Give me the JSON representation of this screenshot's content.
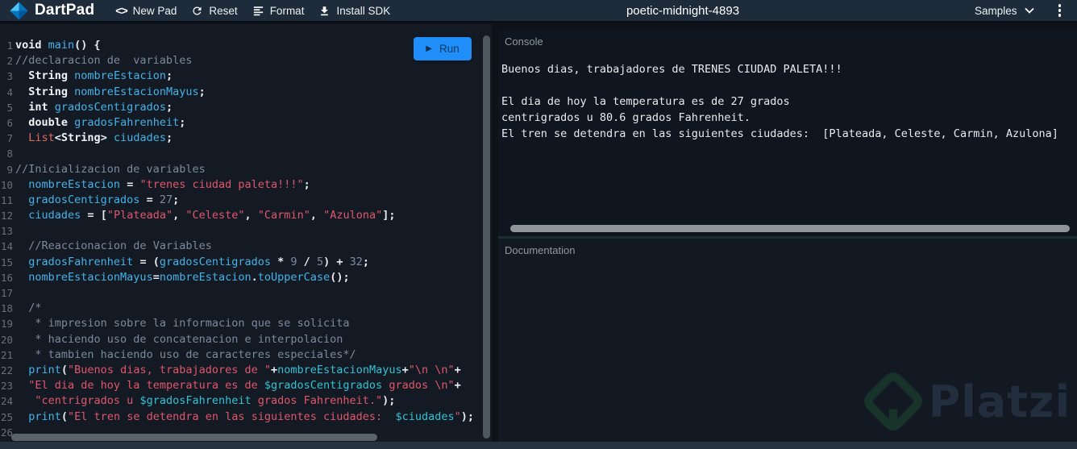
{
  "topbar": {
    "brand": "DartPad",
    "nav": [
      {
        "label": "New Pad",
        "icon": "code-icon"
      },
      {
        "label": "Reset",
        "icon": "refresh-icon"
      },
      {
        "label": "Format",
        "icon": "format-align-icon"
      },
      {
        "label": "Install SDK",
        "icon": "download-icon"
      }
    ],
    "title": "poetic-midnight-4893",
    "samples_label": "Samples"
  },
  "editor": {
    "run_label": "Run",
    "lines": [
      {
        "n": 1,
        "seg": [
          [
            "kw",
            "void "
          ],
          [
            "id",
            "main"
          ],
          [
            "pn",
            "() {"
          ]
        ]
      },
      {
        "n": 2,
        "seg": [
          [
            "cm",
            "//declaracion de  variables"
          ]
        ]
      },
      {
        "n": 3,
        "seg": [
          [
            "pl",
            "  "
          ],
          [
            "kw",
            "String "
          ],
          [
            "id",
            "nombreEstacion"
          ],
          [
            "pn",
            ";"
          ]
        ]
      },
      {
        "n": 4,
        "seg": [
          [
            "pl",
            "  "
          ],
          [
            "kw",
            "String "
          ],
          [
            "id",
            "nombreEstacionMayus"
          ],
          [
            "pn",
            ";"
          ]
        ]
      },
      {
        "n": 5,
        "seg": [
          [
            "pl",
            "  "
          ],
          [
            "kw",
            "int "
          ],
          [
            "id",
            "gradosCentigrados"
          ],
          [
            "pn",
            ";"
          ]
        ]
      },
      {
        "n": 6,
        "seg": [
          [
            "pl",
            "  "
          ],
          [
            "kw",
            "double "
          ],
          [
            "id",
            "gradosFahrenheit"
          ],
          [
            "pn",
            ";"
          ]
        ]
      },
      {
        "n": 7,
        "seg": [
          [
            "pl",
            "  "
          ],
          [
            "ty",
            "List"
          ],
          [
            "pn",
            "<"
          ],
          [
            "kw",
            "String"
          ],
          [
            "pn",
            "> "
          ],
          [
            "id",
            "ciudades"
          ],
          [
            "pn",
            ";"
          ]
        ]
      },
      {
        "n": 8,
        "seg": []
      },
      {
        "n": 9,
        "seg": [
          [
            "cm",
            "//Inicializacion de variables"
          ]
        ]
      },
      {
        "n": 10,
        "seg": [
          [
            "pl",
            "  "
          ],
          [
            "id",
            "nombreEstacion"
          ],
          [
            "op",
            " = "
          ],
          [
            "st",
            "\"trenes ciudad paleta!!!\""
          ],
          [
            "pn",
            ";"
          ]
        ]
      },
      {
        "n": 11,
        "seg": [
          [
            "pl",
            "  "
          ],
          [
            "id",
            "gradosCentigrados"
          ],
          [
            "op",
            " = "
          ],
          [
            "nu",
            "27"
          ],
          [
            "pn",
            ";"
          ]
        ]
      },
      {
        "n": 12,
        "seg": [
          [
            "pl",
            "  "
          ],
          [
            "id",
            "ciudades"
          ],
          [
            "op",
            " = "
          ],
          [
            "pn",
            "["
          ],
          [
            "st",
            "\"Plateada\""
          ],
          [
            "pn",
            ", "
          ],
          [
            "st",
            "\"Celeste\""
          ],
          [
            "pn",
            ", "
          ],
          [
            "st",
            "\"Carmin\""
          ],
          [
            "pn",
            ", "
          ],
          [
            "st",
            "\"Azulona\""
          ],
          [
            "pn",
            "];"
          ]
        ]
      },
      {
        "n": 13,
        "seg": []
      },
      {
        "n": 14,
        "seg": [
          [
            "pl",
            "  "
          ],
          [
            "cm",
            "//Reaccionacion de Variables"
          ]
        ]
      },
      {
        "n": 15,
        "seg": [
          [
            "pl",
            "  "
          ],
          [
            "id",
            "gradosFahrenheit"
          ],
          [
            "op",
            " = "
          ],
          [
            "pn",
            "("
          ],
          [
            "id",
            "gradosCentigrados"
          ],
          [
            "op",
            " * "
          ],
          [
            "nu",
            "9"
          ],
          [
            "op",
            " / "
          ],
          [
            "nu",
            "5"
          ],
          [
            "pn",
            ")"
          ],
          [
            "op",
            " + "
          ],
          [
            "nu",
            "32"
          ],
          [
            "pn",
            ";"
          ]
        ]
      },
      {
        "n": 16,
        "seg": [
          [
            "pl",
            "  "
          ],
          [
            "id",
            "nombreEstacionMayus"
          ],
          [
            "op",
            "="
          ],
          [
            "id",
            "nombreEstacion"
          ],
          [
            "pn",
            "."
          ],
          [
            "id",
            "toUpperCase"
          ],
          [
            "pn",
            "();"
          ]
        ]
      },
      {
        "n": 17,
        "seg": []
      },
      {
        "n": 18,
        "seg": [
          [
            "pl",
            "  "
          ],
          [
            "cm",
            "/*"
          ]
        ]
      },
      {
        "n": 19,
        "seg": [
          [
            "pl",
            "  "
          ],
          [
            "cm",
            " * impresion sobre la informacion que se solicita"
          ]
        ]
      },
      {
        "n": 20,
        "seg": [
          [
            "pl",
            "  "
          ],
          [
            "cm",
            " * haciendo uso de concatenacion e interpolacion"
          ]
        ]
      },
      {
        "n": 21,
        "seg": [
          [
            "pl",
            "  "
          ],
          [
            "cm",
            " * tambien haciendo uso de caracteres especiales*/"
          ]
        ]
      },
      {
        "n": 22,
        "seg": [
          [
            "pl",
            "  "
          ],
          [
            "id",
            "print"
          ],
          [
            "pn",
            "("
          ],
          [
            "st",
            "\"Buenos dias, trabajadores de \""
          ],
          [
            "op",
            "+"
          ],
          [
            "in",
            "nombreEstacionMayus"
          ],
          [
            "op",
            "+"
          ],
          [
            "st",
            "\"\\n \\n\""
          ],
          [
            "op",
            "+"
          ]
        ]
      },
      {
        "n": 23,
        "seg": [
          [
            "pl",
            "  "
          ],
          [
            "st",
            "\"El dia de hoy la temperatura es de "
          ],
          [
            "in",
            "$gradosCentigrados"
          ],
          [
            "st",
            " grados \\n\""
          ],
          [
            "op",
            "+"
          ]
        ]
      },
      {
        "n": 24,
        "seg": [
          [
            "pl",
            "   "
          ],
          [
            "st",
            "\"centrigrados u "
          ],
          [
            "in",
            "$gradosFahrenheit"
          ],
          [
            "st",
            " grados Fahrenheit.\""
          ],
          [
            "pn",
            ");"
          ]
        ]
      },
      {
        "n": 25,
        "seg": [
          [
            "pl",
            "  "
          ],
          [
            "id",
            "print"
          ],
          [
            "pn",
            "("
          ],
          [
            "st",
            "\"El tren se detendra en las siguientes ciudades:  "
          ],
          [
            "in",
            "$ciudades"
          ],
          [
            "st",
            "\""
          ],
          [
            "pn",
            ");"
          ]
        ]
      },
      {
        "n": 26,
        "seg": []
      }
    ]
  },
  "console": {
    "header": "Console",
    "lines": [
      "Buenos dias, trabajadores de TRENES CIUDAD PALETA!!!",
      "",
      "El dia de hoy la temperatura es de 27 grados",
      "centrigrados u 80.6 grados Fahrenheit.",
      "El tren se detendra en las siguientes ciudades:  [Plateada, Celeste, Carmin, Azulona]"
    ]
  },
  "documentation": {
    "header": "Documentation"
  },
  "watermark": {
    "label": "Platzi"
  },
  "colors": {
    "topbar_bg": "#1e2b3a",
    "editor_bg": "#131a23",
    "console_bg": "#0f161f",
    "run_blue": "#1f8ef9",
    "identifier_blue": "#45b2e8",
    "interpolation_teal": "#32c2d4",
    "string_pink": "#e2566c",
    "type_red": "#e06a5a",
    "comment_gray": "#7b8a9e"
  }
}
